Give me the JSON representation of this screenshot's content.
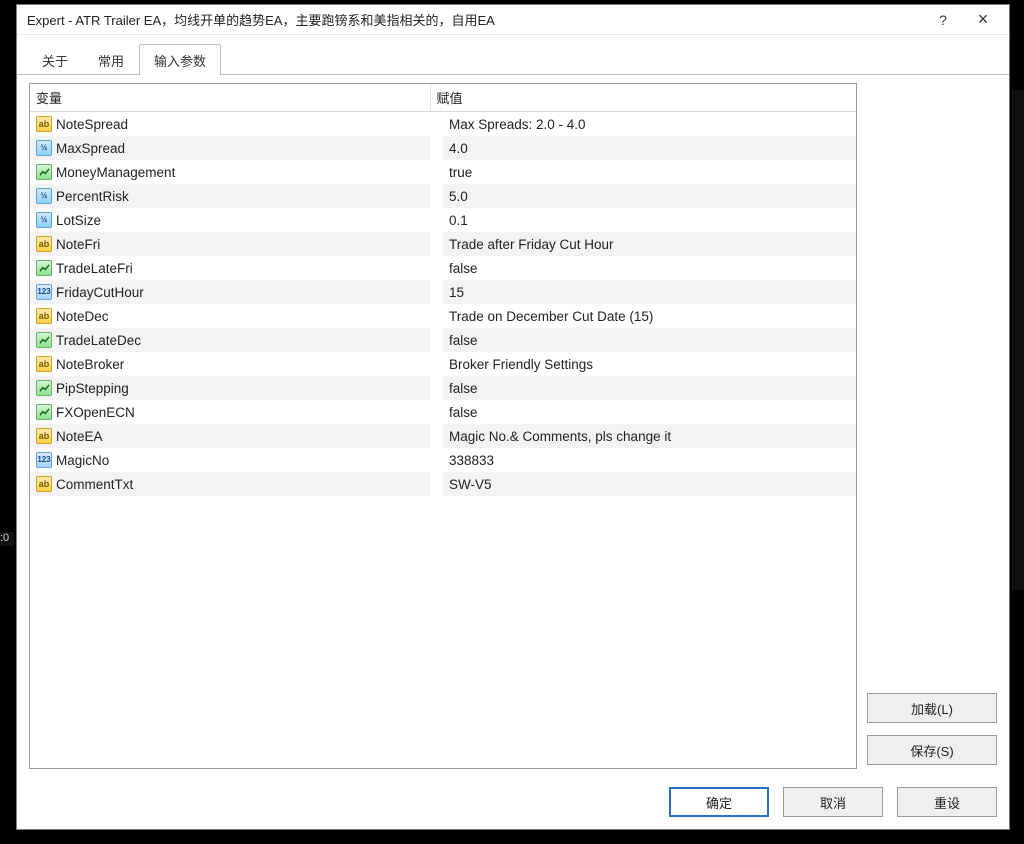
{
  "window": {
    "title": "Expert - ATR Trailer EA，均线开单的趋势EA，主要跑镑系和美指相关的，自用EA",
    "help_label": "?",
    "close_label": "×"
  },
  "tabs": {
    "about": "关于",
    "common": "常用",
    "inputs": "输入参数"
  },
  "columns": {
    "variable": "变量",
    "value": "赋值"
  },
  "buttons": {
    "load": "加载(L)",
    "save": "保存(S)",
    "ok": "确定",
    "cancel": "取消",
    "reset": "重设"
  },
  "rows": [
    {
      "icon": "ab",
      "name": "NoteSpread",
      "value": "Max Spreads: 2.0 - 4.0"
    },
    {
      "icon": "half",
      "name": "MaxSpread",
      "value": "4.0"
    },
    {
      "icon": "chart",
      "name": "MoneyManagement",
      "value": "true"
    },
    {
      "icon": "half",
      "name": "PercentRisk",
      "value": "5.0"
    },
    {
      "icon": "half",
      "name": "LotSize",
      "value": "0.1"
    },
    {
      "icon": "ab",
      "name": "NoteFri",
      "value": "Trade after Friday Cut Hour"
    },
    {
      "icon": "chart",
      "name": "TradeLateFri",
      "value": "false"
    },
    {
      "icon": "num",
      "name": "FridayCutHour",
      "value": "15"
    },
    {
      "icon": "ab",
      "name": "NoteDec",
      "value": "Trade on December Cut Date (15)"
    },
    {
      "icon": "chart",
      "name": "TradeLateDec",
      "value": "false"
    },
    {
      "icon": "ab",
      "name": "NoteBroker",
      "value": "Broker Friendly Settings"
    },
    {
      "icon": "chart",
      "name": "PipStepping",
      "value": "false"
    },
    {
      "icon": "chart",
      "name": "FXOpenECN",
      "value": "false"
    },
    {
      "icon": "ab",
      "name": "NoteEA",
      "value": "Magic No.& Comments, pls change it"
    },
    {
      "icon": "num",
      "name": "MagicNo",
      "value": "338833"
    },
    {
      "icon": "ab",
      "name": "CommentTxt",
      "value": "SW-V5"
    }
  ]
}
